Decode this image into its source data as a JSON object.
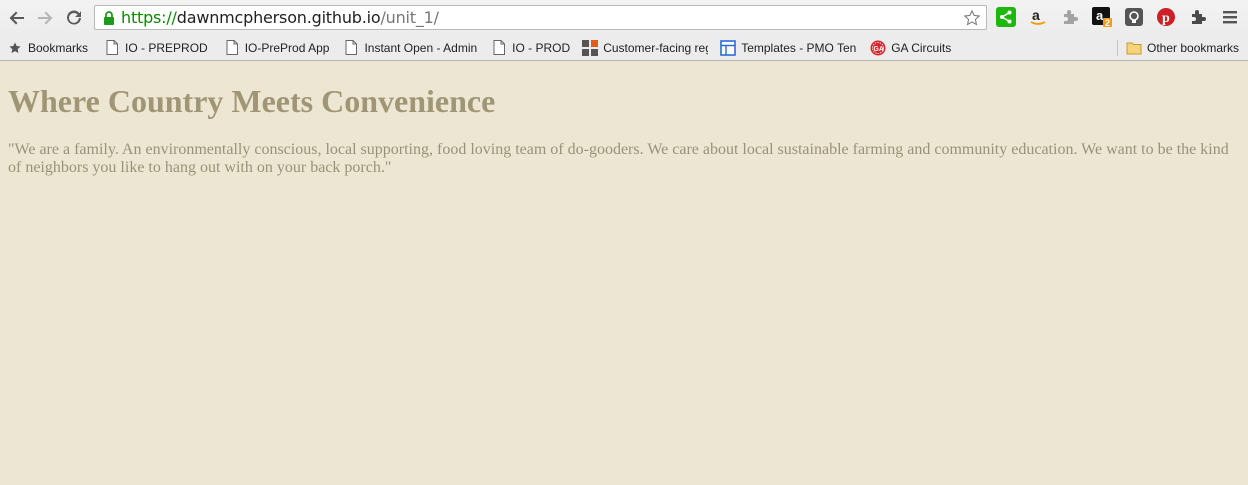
{
  "browser": {
    "url_scheme": "https://",
    "url_host": "dawnmcpherson.github.io",
    "url_path": "/unit_1/"
  },
  "toolbar": {
    "back_icon": "back-arrow-icon",
    "forward_icon": "forward-arrow-icon",
    "reload_icon": "reload-icon",
    "lock_icon": "lock-icon",
    "star_icon": "star-icon",
    "extensions": [
      {
        "name": "share-extension-icon",
        "color": "#1db80e"
      },
      {
        "name": "amazon-smile-icon",
        "color": "#222222"
      },
      {
        "name": "puzzle-extension-icon",
        "color": "#9a9a9a"
      },
      {
        "name": "amazon-assistant-icon",
        "color": "#111111",
        "badge": "2"
      },
      {
        "name": "lightbulb-extension-icon",
        "color": "#555555"
      },
      {
        "name": "pinterest-icon",
        "color": "#cb2027"
      },
      {
        "name": "puzzle-dark-icon",
        "color": "#444444"
      },
      {
        "name": "chrome-menu-icon",
        "color": "#555555"
      }
    ]
  },
  "bookmarks": {
    "items": [
      {
        "label": "Bookmarks",
        "icon": "star-icon"
      },
      {
        "label": "IO - PREPROD",
        "icon": "page-icon"
      },
      {
        "label": "IO-PreProd App",
        "icon": "page-icon"
      },
      {
        "label": "Instant Open - Admin",
        "icon": "page-icon"
      },
      {
        "label": "IO - PROD",
        "icon": "page-icon"
      },
      {
        "label": "Customer-facing regi",
        "icon": "grid-icon"
      },
      {
        "label": "Templates - PMO Ten",
        "icon": "template-icon"
      },
      {
        "label": "GA Circuits",
        "icon": "ga-icon"
      }
    ],
    "other": {
      "label": "Other bookmarks",
      "icon": "folder-icon"
    }
  },
  "page": {
    "heading": "Where Country Meets Convenience",
    "body": "\"We are a family. An environmentally conscious, local supporting, food loving team of do-gooders. We care about local sustainable farming and community education. We want to be the kind of neighbors you like to hang out with on your back porch.\"",
    "background_color": "#ede6d2",
    "text_color": "#a09676"
  }
}
